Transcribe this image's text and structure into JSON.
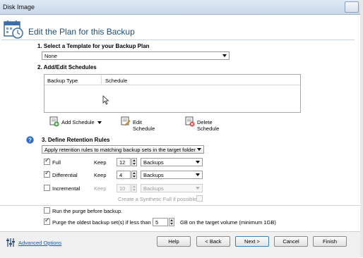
{
  "window": {
    "title": "Disk Image"
  },
  "header": {
    "title": "Edit the Plan for this Backup"
  },
  "template_section": {
    "heading": "1. Select a Template for your Backup Plan",
    "selected": "None"
  },
  "schedules_section": {
    "heading": "2. Add/Edit Schedules",
    "columns": [
      "Backup Type",
      "Schedule"
    ],
    "add_label": "Add Schedule",
    "edit_label": "Edit Schedule",
    "delete_label": "Delete Schedule"
  },
  "retention_section": {
    "heading": "3. Define Retention Rules",
    "mode": "Apply retention rules to matching backup sets in the target folder",
    "keep_label": "Keep",
    "rows": [
      {
        "label": "Full",
        "checked": true,
        "keep": "12",
        "unit": "Backups",
        "enabled": true
      },
      {
        "label": "Differential",
        "checked": true,
        "keep": "4",
        "unit": "Backups",
        "enabled": true
      },
      {
        "label": "Incremental",
        "checked": false,
        "keep": "10",
        "unit": "Backups",
        "enabled": false
      }
    ],
    "synthetic_label": "Create a Synthetic Full if possible"
  },
  "purge": {
    "before_label": "Run the purge before backup.",
    "before_checked": false,
    "oldest_label": "Purge the oldest backup set(s) if less than",
    "oldest_checked": true,
    "oldest_value": "5",
    "oldest_suffix": "GB on the target volume (minimum 1GB)"
  },
  "footer": {
    "advanced_label": "Advanced Options",
    "buttons": [
      "Help",
      "< Back",
      "Next >",
      "Cancel",
      "Finish"
    ]
  }
}
